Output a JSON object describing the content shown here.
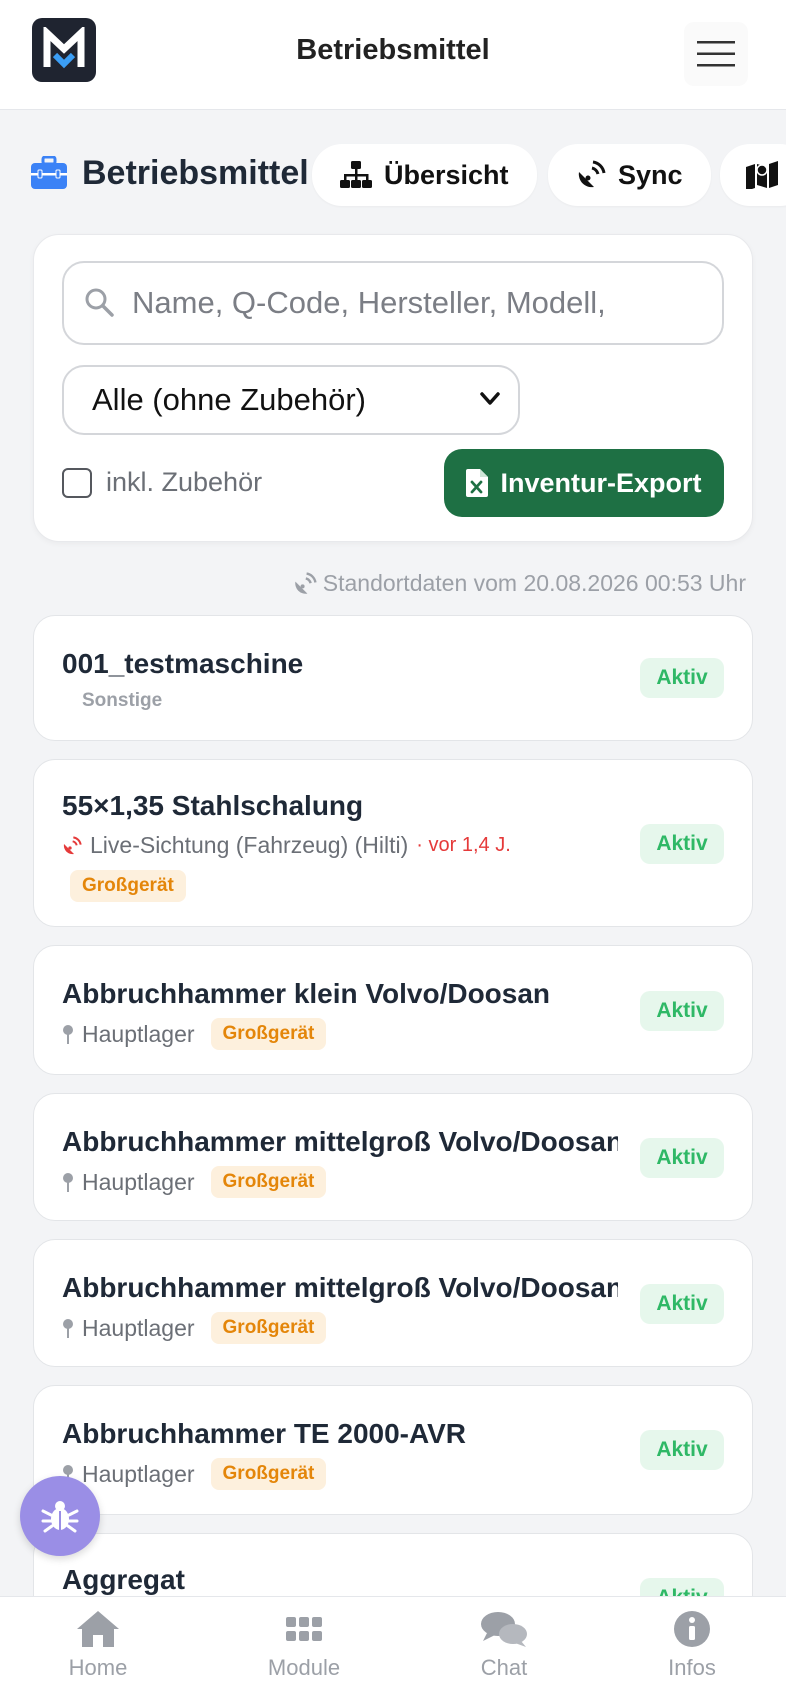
{
  "header": {
    "logo_letter": "M",
    "title": "Betriebsmittel"
  },
  "page": {
    "title": "Betriebsmittel",
    "tabs": [
      {
        "label": "Übersicht",
        "icon": "sitemap-icon"
      },
      {
        "label": "Sync",
        "icon": "satellite-dish-icon"
      },
      {
        "label": "",
        "icon": "map-icon"
      }
    ]
  },
  "filters": {
    "search_placeholder": "Name, Q-Code, Hersteller, Modell,",
    "category_selected": "Alle (ohne Zubehör)",
    "include_accessories_label": "inkl. Zubehör",
    "include_accessories_checked": false,
    "export_label": "Inventur-Export"
  },
  "location_info": "Standortdaten vom 20.08.2026 00:53 Uhr",
  "items": [
    {
      "name": "001_testmaschine",
      "category": "Sonstige",
      "status": "Aktiv"
    },
    {
      "name": "55×1,35 Stahlschalung",
      "live": "Live-Sichtung (Fahrzeug) (Hilti)",
      "live_ago": "· vor 1,4 J.",
      "tag": "Großgerät",
      "status": "Aktiv"
    },
    {
      "name": "Abbruchhammer klein Volvo/Doosan",
      "location": "Hauptlager",
      "tag": "Großgerät",
      "status": "Aktiv"
    },
    {
      "name": "Abbruchhammer mittelgroß Volvo/Doosan",
      "location": "Hauptlager",
      "tag": "Großgerät",
      "status": "Aktiv"
    },
    {
      "name": "Abbruchhammer mittelgroß Volvo/Doosan",
      "location": "Hauptlager",
      "tag": "Großgerät",
      "status": "Aktiv"
    },
    {
      "name": "Abbruchhammer TE 2000-AVR",
      "location": "Hauptlager",
      "tag": "Großgerät",
      "status": "Aktiv"
    },
    {
      "name": "Aggregat",
      "status": "Aktiv"
    }
  ],
  "bottom_nav": [
    {
      "label": "Home",
      "icon": "home-icon"
    },
    {
      "label": "Module",
      "icon": "grid-icon"
    },
    {
      "label": "Chat",
      "icon": "chat-icon"
    },
    {
      "label": "Infos",
      "icon": "info-icon"
    }
  ],
  "colors": {
    "export_green": "#1e7044",
    "aktiv_green": "#2fb866",
    "grossgeraet_orange": "#e4860a",
    "live_red": "#e53a3a",
    "fab_purple": "#9a8ee6",
    "logo_blue": "#3b9ef5"
  }
}
